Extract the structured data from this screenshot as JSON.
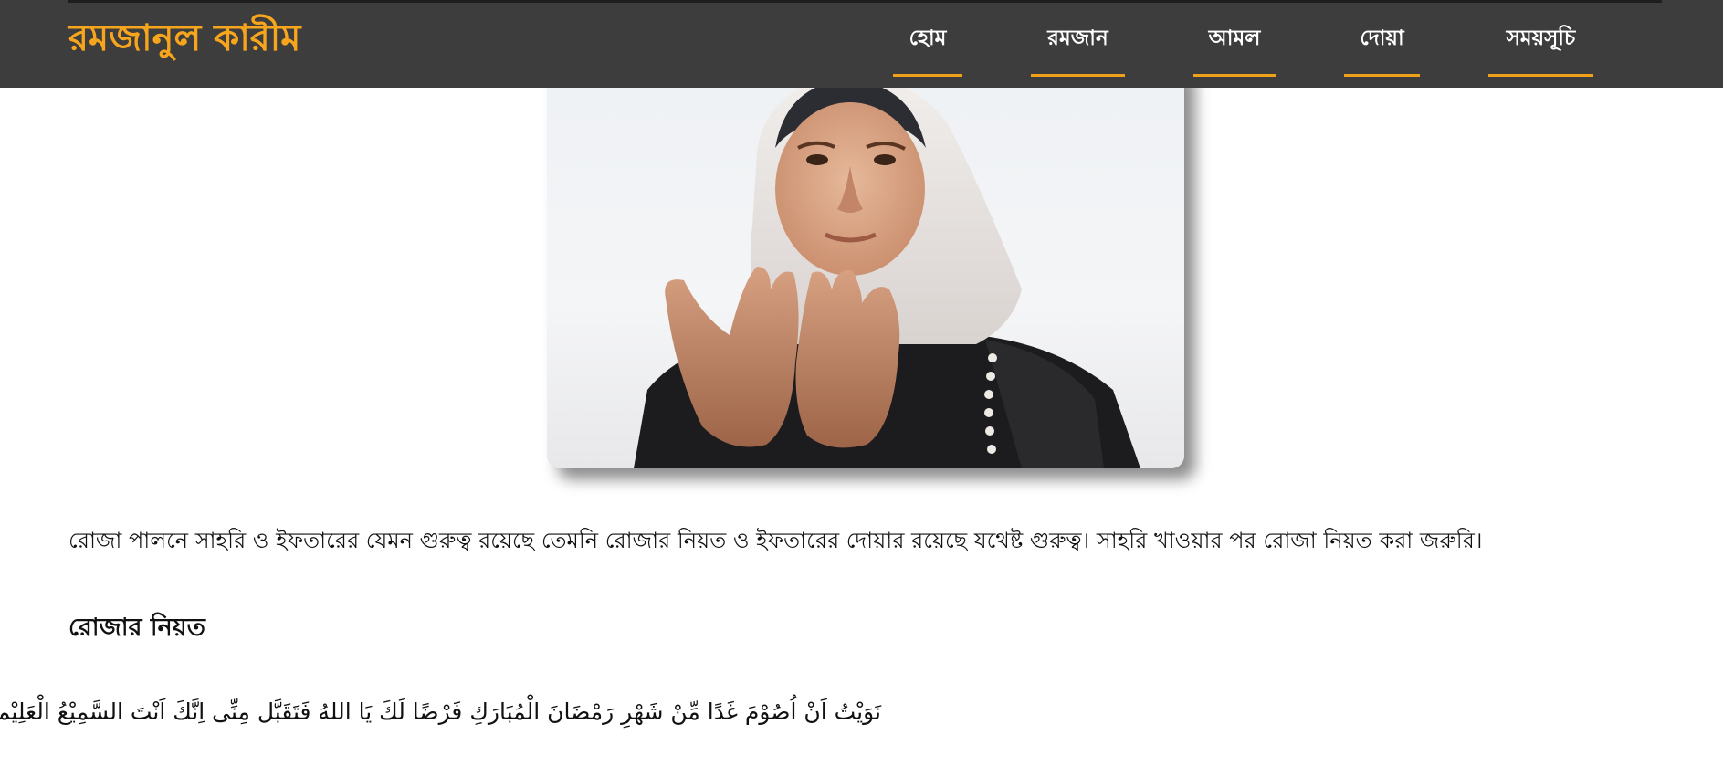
{
  "brand": {
    "title": "রমজানুল কারীম",
    "color": "#f7a51c"
  },
  "nav": {
    "items": [
      {
        "label": "হোম"
      },
      {
        "label": "রমজান"
      },
      {
        "label": "আমল"
      },
      {
        "label": "দোয়া"
      },
      {
        "label": "সময়সূচি"
      }
    ],
    "underline_color": "#f0a01a",
    "background": "#3d3d3d"
  },
  "hero": {
    "image": "girl-praying-photo"
  },
  "content": {
    "intro": "রোজা পালনে সাহরি ও ইফতারের যেমন গুরুত্ব রয়েছে তেমনি রোজার নিয়ত ও ইফতারের দোয়ার রয়েছে যথেষ্ট গুরুত্ব। সাহরি খাওয়ার পর রোজা নিয়ত করা জরুরি।",
    "niyat_heading": "রোজার নিয়ত",
    "niyat_arabic": "نَوَيْتُ اَنْ اُصُوْمَ غَدًا مِّنْ شَهْرِ رَمْضَانَ الْمُبَارَكِ فَرْضًا لَكَ يَا اللهُ فَتَقَبَّل مِنِّى اِنَّكَ اَنْتَ السَّمِيْعُ الْعَلِيْم"
  }
}
